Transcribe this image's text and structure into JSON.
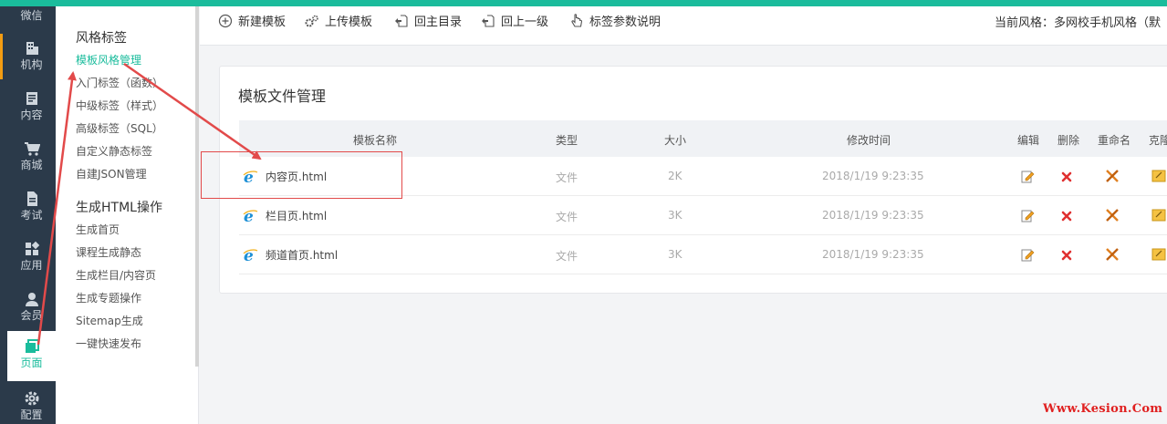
{
  "rail": {
    "items": [
      {
        "label": "微信"
      },
      {
        "label": "机构"
      },
      {
        "label": "内容"
      },
      {
        "label": "商城"
      },
      {
        "label": "考试"
      },
      {
        "label": "应用"
      },
      {
        "label": "会员"
      },
      {
        "label": "页面"
      },
      {
        "label": "配置"
      }
    ]
  },
  "subnav": {
    "section1_title": "风格标签",
    "section1_items": [
      {
        "label": "模板风格管理"
      },
      {
        "label": "入门标签（函数）"
      },
      {
        "label": "中级标签（样式）"
      },
      {
        "label": "高级标签（SQL）"
      },
      {
        "label": "自定义静态标签"
      },
      {
        "label": "自建JSON管理"
      }
    ],
    "section2_title": "生成HTML操作",
    "section2_items": [
      {
        "label": "生成首页"
      },
      {
        "label": "课程生成静态"
      },
      {
        "label": "生成栏目/内容页"
      },
      {
        "label": "生成专题操作"
      },
      {
        "label": "Sitemap生成"
      },
      {
        "label": "一键快速发布"
      }
    ]
  },
  "toolbar": {
    "new_template": "新建模板",
    "upload_template": "上传模板",
    "back_root": "回主目录",
    "back_up": "回上一级",
    "tag_help": "标签参数说明",
    "current_style": "当前风格：多网校手机风格（默"
  },
  "panel": {
    "title": "模板文件管理",
    "columns": {
      "name": "模板名称",
      "type": "类型",
      "size": "大小",
      "modified": "修改时间",
      "edit": "编辑",
      "delete": "删除",
      "rename": "重命名",
      "clone": "克隆"
    },
    "rows": [
      {
        "name": "内容页.html",
        "type": "文件",
        "size": "2K",
        "modified": "2018/1/19 9:23:35"
      },
      {
        "name": "栏目页.html",
        "type": "文件",
        "size": "3K",
        "modified": "2018/1/19 9:23:35"
      },
      {
        "name": "频道首页.html",
        "type": "文件",
        "size": "3K",
        "modified": "2018/1/19 9:23:35"
      }
    ]
  },
  "colors": {
    "accent": "#1abc9c",
    "rail_bg": "#2b3a4a",
    "annotation": "#e24a4a"
  },
  "watermark": "Www.Kesion.Com"
}
